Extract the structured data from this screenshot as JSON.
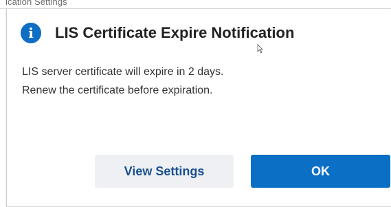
{
  "background_window": {
    "title_fragment": "ication Settings"
  },
  "dialog": {
    "title": "LIS Certificate Expire Notification",
    "icon": "info-icon",
    "message_lines": [
      "LIS server certificate will expire in 2 days.",
      "Renew the certificate before expiration."
    ],
    "buttons": {
      "secondary_label": "View Settings",
      "primary_label": "OK"
    },
    "colors": {
      "accent": "#0b6fc6",
      "icon": "#0e6ec4",
      "secondary_button_bg": "#eef0f3",
      "secondary_button_text": "#1a4f8f"
    }
  }
}
